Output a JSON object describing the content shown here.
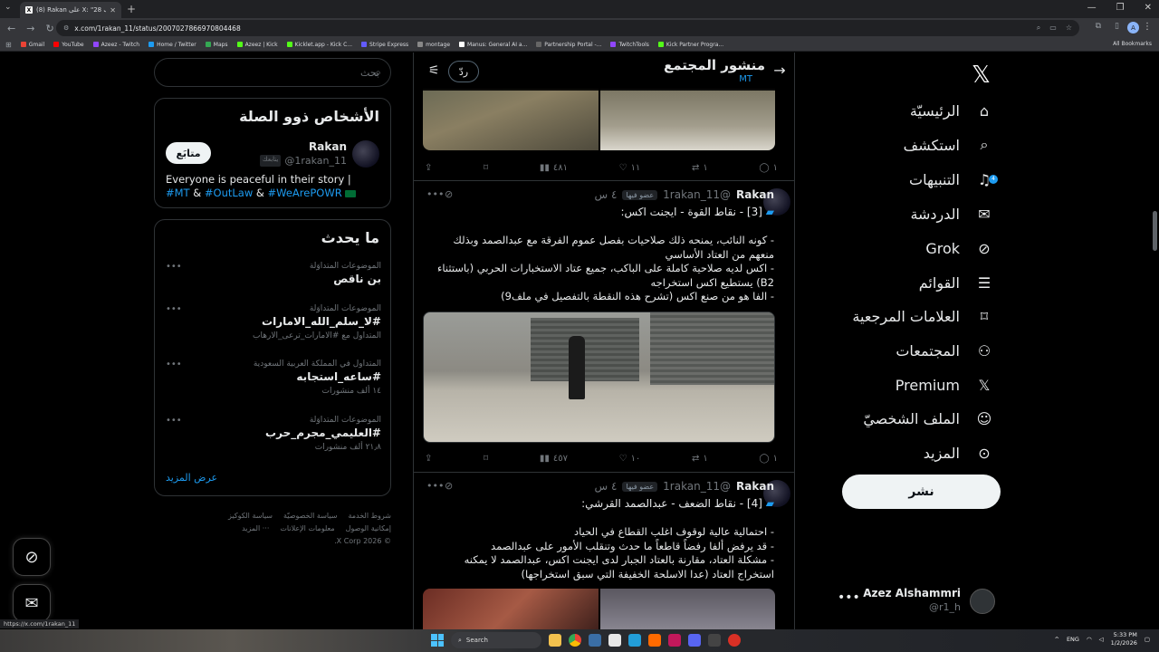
{
  "browser": {
    "tab_title": "(8) Rakan على X: \"الملف 28 ...",
    "url": "x.com/1rakan_11/status/2007027866970804468",
    "bookmarks": [
      "Gmail",
      "YouTube",
      "Azeez - Twitch",
      "Home / Twitter",
      "Maps",
      "Azeez | Kick",
      "Kicklet.app - Kick C...",
      "Stripe Express",
      "montage",
      "Manus: General AI a...",
      "Partnership Portal -...",
      "TwitchTools",
      "Kick Partner Progra..."
    ],
    "bookmark_colors": [
      "#ea4335",
      "#ff0000",
      "#9146ff",
      "#1d9bf0",
      "#34a853",
      "#53fc18",
      "#53fc18",
      "#635bff",
      "#888888",
      "#ffffff",
      "#666666",
      "#9146ff",
      "#53fc18"
    ],
    "all_bookmarks": "All Bookmarks",
    "status_url": "https://x.com/1rakan_11"
  },
  "nav": {
    "items": [
      {
        "label": "الرئيسيّة",
        "icon": "home-icon"
      },
      {
        "label": "استكشف",
        "icon": "search-icon"
      },
      {
        "label": "التنبيهات",
        "icon": "bell-icon",
        "badge": "4"
      },
      {
        "label": "الدردشة",
        "icon": "mail-icon"
      },
      {
        "label": "Grok",
        "icon": "grok-icon"
      },
      {
        "label": "القوائم",
        "icon": "list-icon"
      },
      {
        "label": "العلامات المرجعية",
        "icon": "bookmark-icon"
      },
      {
        "label": "المجتمعات",
        "icon": "communities-icon"
      },
      {
        "label": "Premium",
        "icon": "x-logo-icon"
      },
      {
        "label": "الملف الشخصيّ",
        "icon": "person-icon"
      },
      {
        "label": "المزيد",
        "icon": "more-circle-icon"
      }
    ],
    "post_button": "نشر",
    "account": {
      "name": "Azez Alshammri",
      "handle": "@r1_h"
    }
  },
  "header": {
    "title": "منشور المجتمع",
    "subtitle": "MT",
    "reply_label": "ردّ"
  },
  "posts": [
    {
      "actions": {
        "replies": "١",
        "reposts": "١",
        "likes": "١١",
        "views": "٤٨١"
      }
    },
    {
      "name": "Rakan",
      "handle": "@1rakan_11",
      "tag": "عضو فيها",
      "time": "٤ س",
      "title": "[3] - نقاط القوة - ايجنت اكس:",
      "lines": [
        "- كونه النائب، يمنحه ذلك صلاحيات بفصل عموم الفرقة مع عبدالصمد وبذلك منعهم من العتاد الأساسي",
        "- اكس لديه صلاحية كاملة على الباكب، جميع عتاد الاستخبارات الحربي (باستثناء B2) يستطيع اكس استخراجه",
        "- الفا هو من صنع اكس (تشرح هذه النقطة بالتفصيل في ملف9)"
      ],
      "actions": {
        "replies": "١",
        "reposts": "١",
        "likes": "١٠",
        "views": "٤٥٧"
      }
    },
    {
      "name": "Rakan",
      "handle": "@1rakan_11",
      "tag": "عضو فيها",
      "time": "٤ س",
      "title": "[4] - نقاط الضعف - عبدالصمد القرشي:",
      "lines": [
        "- احتمالية عالية لوقوف اغلب القطاع في الحياد",
        "- قد يرفض ألفا رفضاً قاطعاً ما حدث وتنقلب الأمور على عبدالصمد",
        "- مشكلة العتاد، مقارنة بالعتاد الجبار لدى ايجنت اكس، عبدالصمد لا يمكنه استخراج العتاد (عدا الاسلحة الخفيفة التي سبق استخراجها)"
      ]
    }
  ],
  "sidebar": {
    "search_placeholder": "بحث",
    "related": {
      "title": "الأشخاص ذوو الصلة",
      "name": "Rakan",
      "handle": "@1rakan_11",
      "follows_you": "يتابعك",
      "follow_label": "متابَع",
      "bio_text": "Everyone is peaceful in their story |",
      "bio_tags": [
        "#MT",
        "#OutLaw",
        "#WeArePOWR"
      ],
      "bio_sep": "&"
    },
    "trends": {
      "title": "ما يحدث",
      "items": [
        {
          "context": "الموضوعات المتداوَلة",
          "topic": "بن ناقص",
          "extra": ""
        },
        {
          "context": "الموضوعات المتداوَلة",
          "topic": "#لا_سلم_الله_الامارات",
          "extra": "المتداول مع #الامارات_ترعى_الارهاب"
        },
        {
          "context": "المتداول في المملكة العربية السعودية",
          "topic": "#ساعه_استجابه",
          "extra": "١٤ ألف منشورات"
        },
        {
          "context": "الموضوعات المتداوَلة",
          "topic": "#العليمي_مجرم_حرب",
          "extra": "٢١٫٨ ألف منشورات"
        }
      ],
      "show_more": "عرض المزيد"
    },
    "footer": {
      "row1": [
        "شروط الخدمة",
        "سياسة الخصوصيّة",
        "سياسة الكوكيز"
      ],
      "row2": [
        "إمكانية الوصول",
        "معلومات الإعلانات",
        "··· المزيد"
      ],
      "copyright": "© 2026 X Corp."
    }
  },
  "taskbar": {
    "search": "Search",
    "lang": "ENG",
    "time": "5:33 PM",
    "date": "1/2/2026"
  }
}
